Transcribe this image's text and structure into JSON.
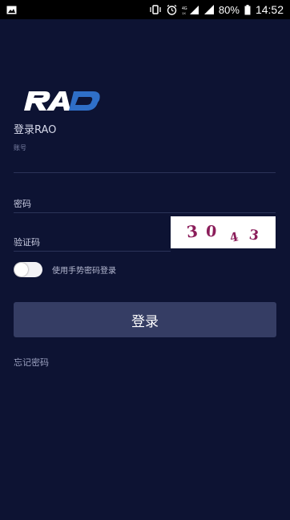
{
  "status_bar": {
    "battery": "80%",
    "time": "14:52",
    "icons": [
      "image-icon",
      "vibrate-icon",
      "alarm-icon",
      "signal-4g-icon",
      "signal-icon",
      "battery-icon"
    ],
    "network": "4G"
  },
  "logo": {
    "text": "RAO",
    "color": "#ffffff",
    "accent": "#2f6fc8"
  },
  "login": {
    "title": "登录RAO",
    "account_label": "账号",
    "password_placeholder": "密码",
    "captcha_placeholder": "验证码",
    "captcha_text": "3043",
    "gesture_toggle_label": "使用手势密码登录",
    "gesture_toggle_on": false,
    "submit_label": "登录",
    "forgot_label": "忘记密码"
  },
  "colors": {
    "background": "#0d1333",
    "button": "#353d64",
    "captcha_digit": "#8b1d5a"
  }
}
